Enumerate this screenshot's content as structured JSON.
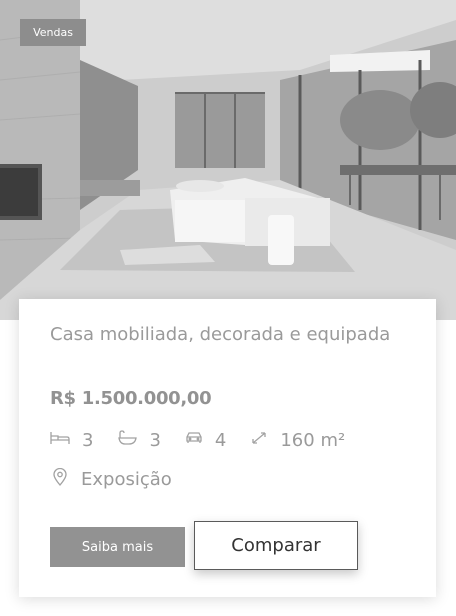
{
  "listing": {
    "badge": "Vendas",
    "title": "Casa mobiliada, decorada e equipada",
    "price": "R$ 1.500.000,00",
    "features": {
      "bedrooms": "3",
      "bathrooms": "3",
      "parking": "4",
      "area": "160 m²"
    },
    "location": "Exposição"
  },
  "actions": {
    "primary_label": "Saiba mais",
    "secondary_label": "Comparar"
  },
  "colors": {
    "badge_bg": "#8d8d8d",
    "primary_button_bg": "#929292",
    "text_muted": "#9a9a9a"
  },
  "icons": {
    "bedrooms": "bed-icon",
    "bathrooms": "bathtub-icon",
    "parking": "car-icon",
    "area": "expand-arrows-icon",
    "location": "map-pin-icon"
  }
}
